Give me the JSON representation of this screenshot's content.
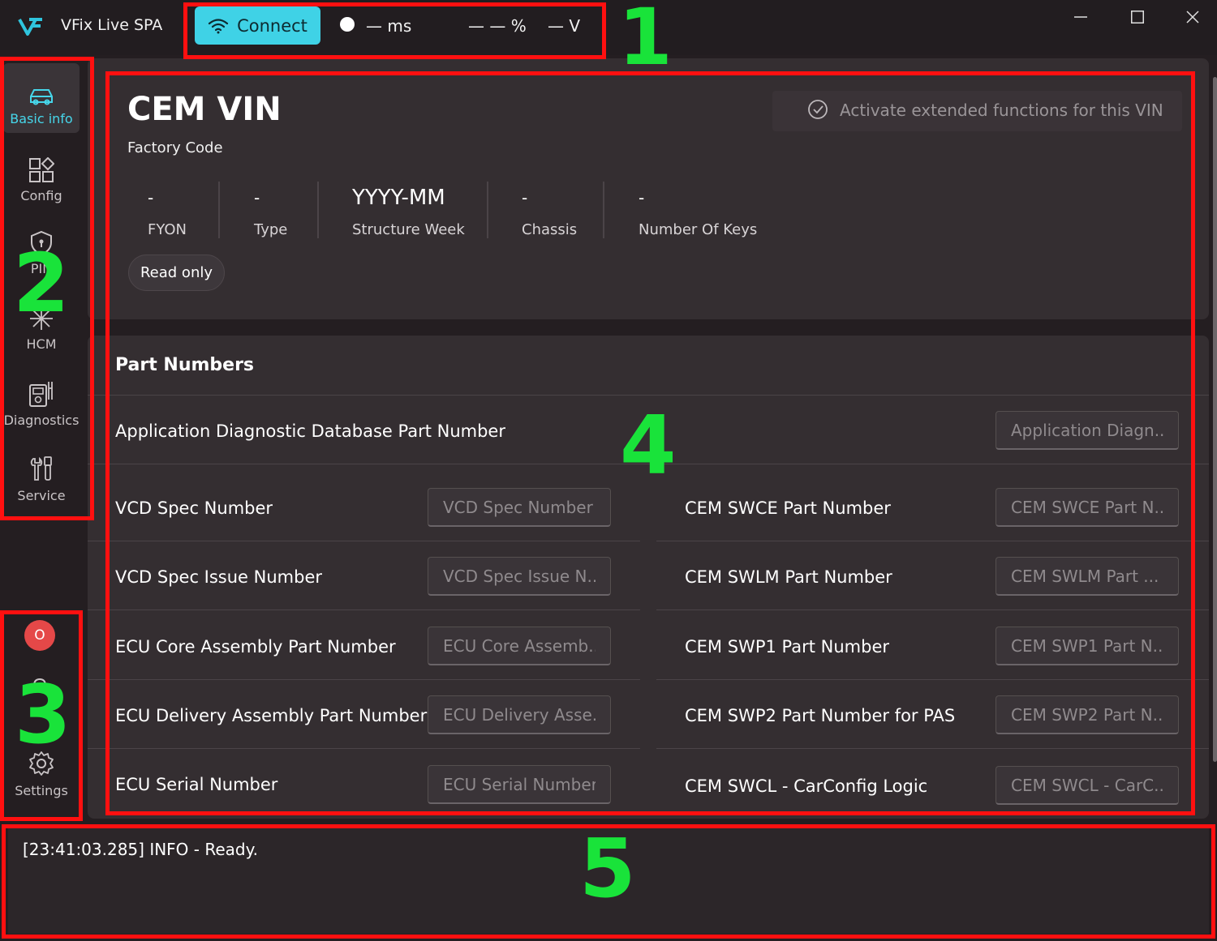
{
  "titlebar": {
    "app_title": "VFix Live SPA",
    "connect_label": "Connect",
    "latency": "— ms",
    "percent": "— — %",
    "voltage": "— V"
  },
  "sidebar": {
    "items": [
      {
        "label": "Basic info",
        "icon": "car-icon",
        "active": true
      },
      {
        "label": "Config",
        "icon": "config-grid-icon"
      },
      {
        "label": "PIN",
        "icon": "shield-lock-icon"
      },
      {
        "label": "HCM",
        "icon": "sparkle-icon"
      },
      {
        "label": "Diagnostics",
        "icon": "diagnostics-icon"
      },
      {
        "label": "Service",
        "icon": "tools-icon"
      }
    ],
    "bottom": {
      "record_label": "O",
      "settings_label": "Settings"
    }
  },
  "vin": {
    "title": "CEM VIN",
    "factory_code_label": "Factory Code",
    "extended_label": "Activate extended functions for this VIN",
    "fields": [
      {
        "value": "-",
        "label": "FYON"
      },
      {
        "value": "-",
        "label": "Type"
      },
      {
        "value": "YYYY-MM",
        "label": "Structure Week"
      },
      {
        "value": "-",
        "label": "Chassis"
      },
      {
        "value": "-",
        "label": "Number Of Keys"
      }
    ],
    "readonly_label": "Read only"
  },
  "parts": {
    "title": "Part Numbers",
    "full_row": {
      "label": "Application Diagnostic Database Part Number",
      "placeholder": "Application Diagn..."
    },
    "left": [
      {
        "label": "VCD Spec Number",
        "placeholder": "VCD Spec Number"
      },
      {
        "label": "VCD Spec Issue Number",
        "placeholder": "VCD Spec Issue N..."
      },
      {
        "label": "ECU Core Assembly Part Number",
        "placeholder": "ECU Core Assemb..."
      },
      {
        "label": "ECU Delivery Assembly Part Number",
        "placeholder": "ECU Delivery Asse..."
      },
      {
        "label": "ECU Serial Number",
        "placeholder": "ECU Serial Number"
      }
    ],
    "right": [
      {
        "label": "CEM SWCE Part Number",
        "placeholder": "CEM SWCE Part N..."
      },
      {
        "label": "CEM SWLM Part Number",
        "placeholder": "CEM SWLM Part ..."
      },
      {
        "label": "CEM SWP1 Part Number",
        "placeholder": "CEM SWP1 Part N..."
      },
      {
        "label": "CEM SWP2 Part Number for PAS",
        "placeholder": "CEM SWP2 Part N..."
      },
      {
        "label": "CEM SWCL - CarConfig Logic",
        "placeholder": "CEM SWCL - CarC..."
      }
    ]
  },
  "log": {
    "line": "[23:41:03.285] INFO - Ready."
  },
  "annotations": [
    "1",
    "2",
    "3",
    "4",
    "5"
  ],
  "colors": {
    "accent": "#46d6ea",
    "annotation_box": "#ff1010",
    "annotation_number": "#19e33a",
    "record": "#e54848"
  }
}
